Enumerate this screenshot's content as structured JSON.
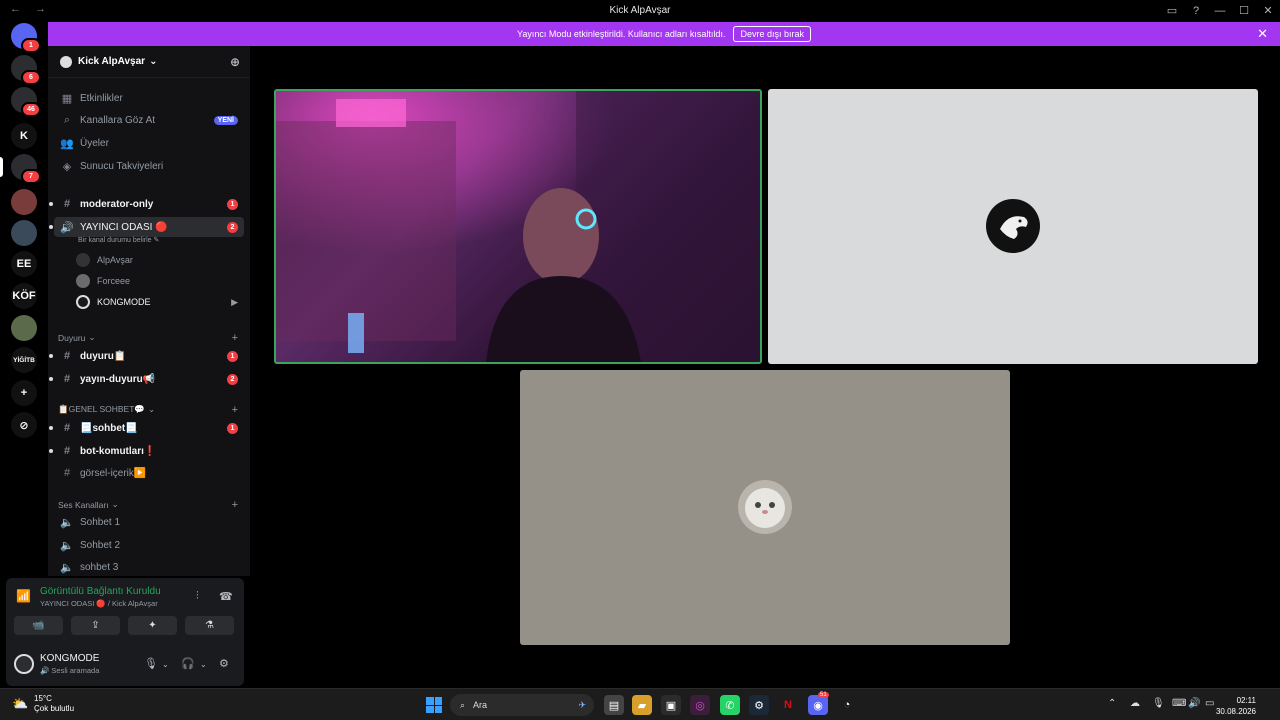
{
  "window": {
    "title": "Kick AlpAvşar",
    "back": "←",
    "forward": "→",
    "minimize": "—",
    "maximize": "☐",
    "close": "✕",
    "inbox_icon": "inbox-icon",
    "help": "?"
  },
  "banner": {
    "text": "Yayıncı Modu etkinleştirildi. Kullanıcı adları kısaltıldı.",
    "button": "Devre dışı bırak",
    "close": "✕"
  },
  "servers": [
    {
      "label": "",
      "badge": "1",
      "color": "#5865f2"
    },
    {
      "label": "",
      "badge": "6",
      "color": "#2b2d31"
    },
    {
      "label": "",
      "badge": "46",
      "color": "#2b2d31"
    },
    {
      "label": "K",
      "badge": "",
      "color": "#111"
    },
    {
      "label": "",
      "badge": "7",
      "color": "#2b2d31"
    },
    {
      "label": "",
      "badge": "",
      "color": "#7a3b3b"
    },
    {
      "label": "",
      "badge": "",
      "color": "#3a4a5a"
    },
    {
      "label": "EE",
      "badge": "",
      "color": "#111"
    },
    {
      "label": "KÖF",
      "badge": "",
      "color": "#111"
    },
    {
      "label": "",
      "badge": "",
      "color": "#5a6a4a"
    },
    {
      "label": "YİĞİTB",
      "badge": "",
      "color": "#111"
    },
    {
      "label": "+",
      "badge": "",
      "color": "#111"
    },
    {
      "label": "⊘",
      "badge": "",
      "color": "#111"
    }
  ],
  "guild": {
    "name": "Kick AlpAvşar",
    "chevron": "⌄",
    "invite_icon": "person-add-icon"
  },
  "menu": [
    {
      "label": "Etkinlikler",
      "icon": "▦"
    },
    {
      "label": "Kanallara Göz At",
      "icon": "⌕",
      "badge": "YENİ"
    },
    {
      "label": "Üyeler",
      "icon": "👥"
    },
    {
      "label": "Sunucu Takviyeleri",
      "icon": "◈"
    }
  ],
  "channels_top": [
    {
      "label": "moderator-only",
      "icon": "#",
      "count": "1"
    },
    {
      "label": "YAYINCI ODASI 🔴",
      "icon": "🔊",
      "count": "2",
      "status": "Bir kanal durumu belirle ✎"
    }
  ],
  "voice_users": [
    {
      "name": "AlpAvşar",
      "avatar_color": "#333",
      "cam": ""
    },
    {
      "name": "Forceee",
      "avatar_color": "#6b6b6b",
      "cam": ""
    },
    {
      "name": "KONGMODE",
      "avatar_color": "#1a1a1a",
      "cam": "▶"
    }
  ],
  "cat_duyuru": {
    "label": "Duyuru",
    "chevron": "⌄",
    "plus": "+"
  },
  "channels_duyuru": [
    {
      "label": "duyuru📋",
      "icon": "#",
      "count": "1"
    },
    {
      "label": "yayın-duyuru📢",
      "icon": "#",
      "count": "2"
    }
  ],
  "cat_genel": {
    "label": "📋GENEL SOHBET💬",
    "chevron": "⌄",
    "plus": "+"
  },
  "channels_genel": [
    {
      "label": "📃sohbet📃",
      "icon": "#",
      "count": "1"
    },
    {
      "label": "bot-komutları❗",
      "icon": "#",
      "count": ""
    },
    {
      "label": "görsel-içerik▶️",
      "icon": "#",
      "count": ""
    }
  ],
  "cat_ses": {
    "label": "Ses Kanalları",
    "chevron": "⌄",
    "plus": "+"
  },
  "channels_ses": [
    {
      "label": "Sohbet 1",
      "icon": "🔈"
    },
    {
      "label": "Sohbet 2",
      "icon": "🔈"
    },
    {
      "label": "sohbet 3",
      "icon": "🔈"
    }
  ],
  "voice_panel": {
    "title": "Görüntülü Bağlantı Kuruldu",
    "subtitle": "YAYINCI ODASI 🔴 / Kick AlpAvşar",
    "signal_icon": "signal-icon",
    "buttons": [
      "📹",
      "⇪",
      "✦",
      "⚗"
    ]
  },
  "me": {
    "name": "KONGMODE",
    "status": "🔊 Sesli aramada",
    "mic": "🎙",
    "headset": "🎧",
    "settings": "⚙",
    "chevron": "⌄"
  },
  "taskbar": {
    "temp": "15°C",
    "weather": "Çok bulutlu",
    "search": "Ara",
    "time": "02:11",
    "date": "30.08.2026",
    "discord_badge": "51",
    "tray_chevron": "⌃"
  }
}
